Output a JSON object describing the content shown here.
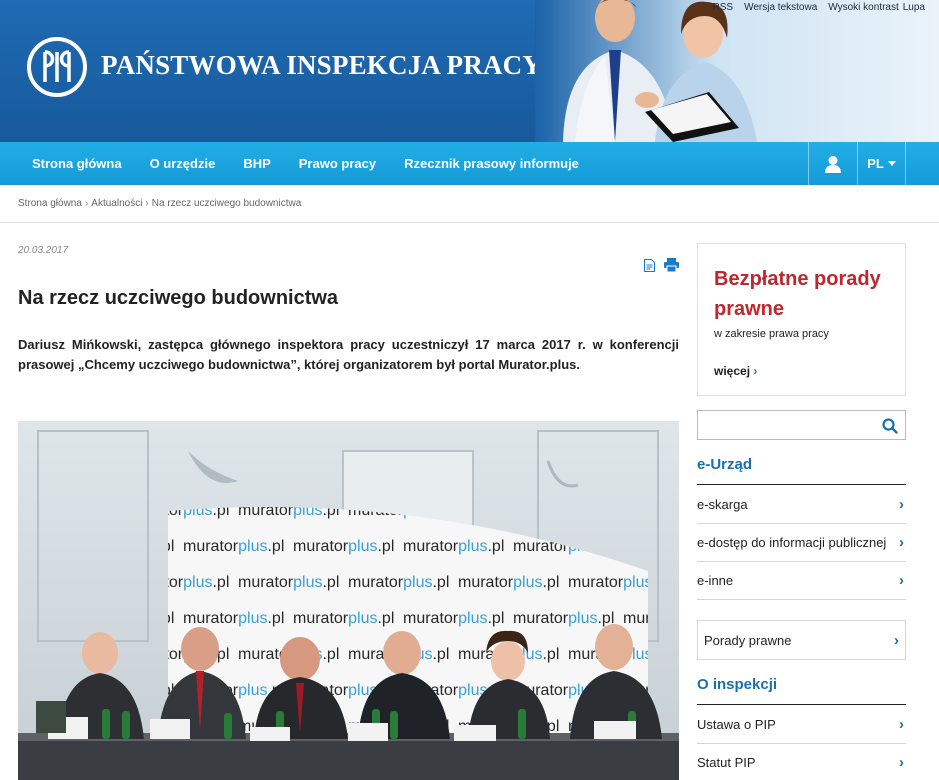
{
  "header": {
    "logo_text": "PAŃSTWOWA INSPEKCJA PRACY",
    "top_links": [
      "RSS",
      "Wersja tekstowa",
      "Wysoki kontrast",
      "Lupa"
    ]
  },
  "nav": {
    "items": [
      "Strona główna",
      "O urzędzie",
      "BHP",
      "Prawo pracy",
      "Rzecznik prasowy informuje"
    ],
    "user_icon": "user-icon",
    "language": "PL"
  },
  "breadcrumb": [
    "Strona główna",
    "Aktualności",
    "Na rzecz uczciwego budownictwa"
  ],
  "article": {
    "date": "20.03.2017",
    "title": "Na rzecz uczciwego budownictwa",
    "lead": "Dariusz Mińkowski, zastępca głównego inspektora pracy uczestniczył 17 marca 2017 r. w konferencji prasowej „Chcemy uczciwego budownictwa”, której organizatorem był portal Murator.plus.",
    "tool_icons": [
      "document-icon",
      "print-icon"
    ],
    "photo_banner_text": "muratorplus.pl"
  },
  "sidebar": {
    "promo": {
      "title": "Bezpłatne porady prawne",
      "subtitle": "w zakresie prawa pracy",
      "more": "więcej"
    },
    "search": {
      "placeholder": "",
      "icon": "search-icon"
    },
    "eurzad": {
      "heading": "e-Urząd",
      "links": [
        "e-skarga",
        "e-dostęp do informacji publicznej",
        "e-inne"
      ]
    },
    "porady_box": "Porady prawne",
    "inspekcja": {
      "heading": "O inspekcji",
      "links": [
        "Ustawa o PIP",
        "Statut PIP"
      ]
    }
  },
  "colors": {
    "header_blue": "#1a62a8",
    "nav_blue": "#1aa3de",
    "promo_red": "#c0262d",
    "link_blue": "#1a6fae"
  }
}
